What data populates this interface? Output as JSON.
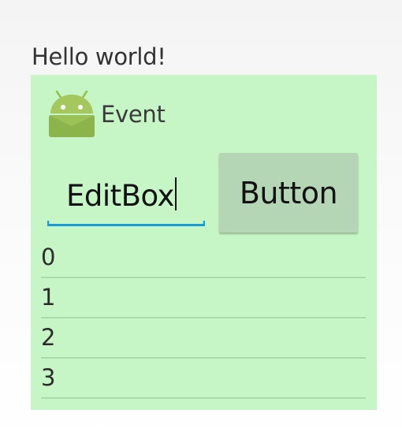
{
  "header": {
    "text": "Hello world!"
  },
  "panel": {
    "icon": "android-robot-icon",
    "event_label": "Event",
    "editbox": {
      "value": "EditBox",
      "focused": true
    },
    "button_label": "Button",
    "list_items": [
      "0",
      "1",
      "2",
      "3"
    ]
  },
  "colors": {
    "panel_background": "#c6f6c6",
    "button_background": "#b5d6b5",
    "focus_underline": "#1a9ad6",
    "list_divider": "#a9dca9"
  }
}
